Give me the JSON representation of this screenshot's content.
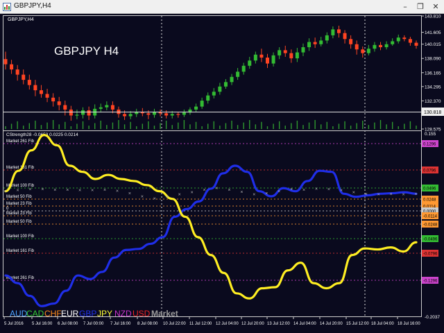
{
  "window": {
    "title": "GBPJPY,H4",
    "minimize_glyph": "–",
    "restore_glyph": "❐",
    "close_glyph": "✕"
  },
  "main_pane": {
    "symbol_label": "GBPJPY,H4",
    "watermark": "GBPJPY H4",
    "price_scale": [
      "143.810",
      "141.605",
      "140.015",
      "138.090",
      "136.165",
      "134.295",
      "132.370",
      "130.818",
      "128.575"
    ],
    "current_price": "130.818",
    "candles": [
      [
        138.0,
        137.3,
        139.0,
        136.6
      ],
      [
        137.3,
        136.6,
        137.9,
        136.0
      ],
      [
        136.6,
        135.9,
        137.2,
        135.1
      ],
      [
        135.9,
        135.2,
        136.6,
        134.6
      ],
      [
        135.2,
        134.5,
        135.9,
        133.9
      ],
      [
        134.5,
        133.8,
        135.2,
        133.0
      ],
      [
        133.8,
        133.3,
        134.5,
        132.8
      ],
      [
        133.3,
        132.8,
        134.0,
        132.2
      ],
      [
        132.8,
        132.3,
        133.4,
        131.6
      ],
      [
        132.3,
        131.8,
        132.9,
        131.1
      ],
      [
        131.8,
        131.2,
        132.4,
        130.4
      ],
      [
        131.2,
        130.4,
        131.7,
        129.7
      ],
      [
        130.4,
        130.5,
        131.2,
        129.9
      ],
      [
        130.5,
        131.1,
        131.5,
        130.0
      ],
      [
        131.1,
        130.4,
        131.6,
        129.8
      ],
      [
        130.4,
        131.3,
        131.9,
        130.0
      ],
      [
        131.3,
        131.5,
        132.0,
        130.8
      ],
      [
        131.5,
        131.8,
        132.3,
        131.1
      ],
      [
        131.8,
        131.2,
        132.3,
        130.7
      ],
      [
        131.2,
        130.6,
        131.6,
        130.1
      ],
      [
        130.6,
        130.3,
        131.1,
        129.8
      ],
      [
        130.3,
        130.6,
        131.0,
        129.9
      ],
      [
        130.6,
        130.9,
        131.3,
        130.2
      ],
      [
        130.9,
        130.7,
        131.4,
        130.3
      ],
      [
        130.7,
        130.5,
        131.1,
        129.9
      ],
      [
        130.5,
        130.9,
        131.3,
        130.1
      ],
      [
        130.9,
        130.7,
        131.2,
        130.3
      ],
      [
        130.7,
        130.4,
        131.1,
        130.0
      ],
      [
        130.4,
        130.6,
        131.0,
        130.0
      ],
      [
        130.6,
        130.5,
        130.9,
        130.1
      ],
      [
        130.5,
        130.8,
        131.2,
        130.2
      ],
      [
        130.8,
        131.2,
        131.5,
        130.5
      ],
      [
        131.2,
        131.6,
        132.0,
        130.9
      ],
      [
        131.6,
        132.4,
        132.8,
        131.3
      ],
      [
        132.4,
        133.1,
        133.5,
        132.0
      ],
      [
        133.1,
        133.6,
        134.1,
        132.7
      ],
      [
        133.6,
        134.3,
        134.8,
        133.2
      ],
      [
        134.3,
        134.9,
        135.3,
        134.0
      ],
      [
        134.9,
        135.6,
        136.0,
        134.5
      ],
      [
        135.6,
        136.3,
        136.8,
        135.2
      ],
      [
        136.3,
        137.1,
        137.5,
        135.9
      ],
      [
        137.1,
        137.8,
        138.3,
        136.7
      ],
      [
        137.8,
        138.6,
        139.0,
        137.4
      ],
      [
        138.6,
        138.2,
        139.4,
        137.6
      ],
      [
        138.2,
        137.4,
        138.7,
        136.8
      ],
      [
        137.4,
        138.5,
        138.9,
        137.0
      ],
      [
        138.5,
        139.2,
        139.6,
        138.0
      ],
      [
        139.2,
        138.8,
        139.8,
        138.3
      ],
      [
        138.8,
        138.1,
        139.3,
        137.5
      ],
      [
        138.1,
        138.9,
        139.5,
        137.6
      ],
      [
        138.9,
        139.6,
        140.1,
        138.4
      ],
      [
        139.6,
        140.3,
        140.8,
        139.1
      ],
      [
        140.3,
        140.0,
        140.9,
        139.5
      ],
      [
        140.0,
        140.5,
        141.0,
        139.7
      ],
      [
        140.5,
        141.2,
        141.6,
        140.1
      ],
      [
        141.2,
        142.0,
        142.4,
        140.8
      ],
      [
        142.0,
        141.5,
        142.5,
        140.9
      ],
      [
        141.5,
        140.7,
        141.9,
        140.1
      ],
      [
        140.7,
        140.0,
        141.2,
        139.4
      ],
      [
        140.0,
        139.3,
        140.5,
        138.6
      ],
      [
        139.3,
        138.8,
        139.7,
        138.2
      ],
      [
        138.8,
        139.4,
        139.9,
        138.5
      ],
      [
        139.4,
        139.9,
        140.3,
        139.0
      ],
      [
        139.9,
        139.6,
        140.3,
        139.2
      ],
      [
        139.6,
        140.0,
        140.4,
        139.3
      ],
      [
        140.0,
        140.4,
        140.8,
        139.8
      ],
      [
        140.4,
        140.9,
        141.3,
        140.1
      ],
      [
        140.9,
        140.7,
        141.2,
        140.4
      ],
      [
        140.7,
        140.2,
        141.0,
        139.8
      ],
      [
        140.2,
        139.8,
        140.5,
        139.4
      ]
    ]
  },
  "indicator_pane": {
    "header": "CStrength28 -0.0653 0.0225 0.0214",
    "scale_top": "0.155",
    "scale_bottom": "-0.2037",
    "levels": [
      {
        "label": "Market 261 Fib",
        "badge": "0.1296",
        "color": "#cc44cc"
      },
      {
        "label": "Market 161 Fib",
        "badge": "0.0796",
        "color": "#dd3333"
      },
      {
        "label": "Market 100 Fib",
        "badge": "0.0496",
        "color": "#33bb33"
      },
      {
        "label": "Market 50 Fib",
        "badge": "0.0248",
        "color": "#ff9933"
      },
      {
        "label": "Market 23 Fib",
        "badge": "0.0114",
        "color": "#ff9933"
      },
      {
        "label": "0",
        "badge": "0.0000",
        "color": "#cccccc"
      },
      {
        "label": "Market 23 Fib",
        "badge": "-0.0114",
        "color": "#ff9933"
      },
      {
        "label": "Market 50 Fib",
        "badge": "-0.0248",
        "color": "#ff9933"
      },
      {
        "label": "Market 100 Fib",
        "badge": "-0.0496",
        "color": "#33bb33"
      },
      {
        "label": "Market 161 Fib",
        "badge": "-0.0796",
        "color": "#dd3333"
      },
      {
        "label": "Market 261 Fib",
        "badge": "-0.1296",
        "color": "#cc44cc"
      }
    ],
    "currency_legend": [
      {
        "code": "AUD",
        "color": "#4aa3ff"
      },
      {
        "code": "CAD",
        "color": "#33cc33"
      },
      {
        "code": "CHF",
        "color": "#ff8c1a"
      },
      {
        "code": "EUR",
        "color": "#ffffff"
      },
      {
        "code": "GBP",
        "color": "#2233ee"
      },
      {
        "code": "JPY",
        "color": "#ffff33"
      },
      {
        "code": "NZD",
        "color": "#cc33cc"
      },
      {
        "code": "USD",
        "color": "#ee2222"
      },
      {
        "code": "Market",
        "color": "#9a9a9a"
      }
    ]
  },
  "time_axis": [
    "5 Jul 2016",
    "5 Jul 16:00",
    "6 Jul 08:00",
    "7 Jul 00:00",
    "7 Jul 16:00",
    "8 Jul 08:00",
    "10 Jul 22:00",
    "11 Jul 12:00",
    "12 Jul 04:00",
    "12 Jul 20:00",
    "13 Jul 12:00",
    "14 Jul 04:00",
    "14 Jul 20:00",
    "15 Jul 12:00",
    "18 Jul 04:00",
    "18 Jul 16:00"
  ],
  "colors": {
    "background": "#0a0a1e",
    "bull": "#33bb33",
    "bear": "#ff4422",
    "jpy_line": "#ffee22",
    "gbp_line": "#1f2ee8",
    "market_line": "#b0b0b0",
    "grid": "#ffffff"
  },
  "chart_data": {
    "type": "line",
    "series": [
      {
        "name": "GBP",
        "color": "#1f2ee8",
        "values": [
          -0.125,
          -0.14,
          -0.165,
          -0.185,
          -0.18,
          -0.155,
          -0.125,
          -0.132,
          -0.118,
          -0.09,
          -0.075,
          -0.073,
          -0.063,
          -0.05,
          -0.01,
          0.005,
          0.02,
          0.045,
          0.075,
          0.09,
          0.078,
          0.04,
          0.03,
          0.046,
          0.04,
          0.06,
          0.08,
          0.078,
          0.035,
          0.029,
          0.032,
          0.035,
          0.036,
          0.038,
          0.035
        ]
      },
      {
        "name": "JPY",
        "color": "#ffee22",
        "values": [
          0.04,
          0.08,
          0.12,
          0.15,
          0.13,
          0.09,
          0.078,
          0.064,
          0.072,
          0.064,
          0.06,
          0.052,
          0.04,
          0.025,
          -0.01,
          -0.05,
          -0.085,
          -0.12,
          -0.16,
          -0.17,
          -0.15,
          -0.148,
          -0.115,
          -0.1,
          -0.14,
          -0.15,
          -0.14,
          -0.085,
          -0.072,
          -0.074,
          -0.07,
          -0.078,
          -0.06
        ]
      },
      {
        "name": "Market",
        "color": "#b0b0b0",
        "values": [
          0.04,
          0.042,
          0.044,
          0.044,
          0.043,
          0.043,
          0.042,
          0.042,
          0.043,
          0.041,
          0.036,
          0.03,
          0.026,
          0.03,
          0.034,
          0.038,
          0.043,
          0.046,
          0.043,
          0.039,
          0.034,
          0.036,
          0.04,
          0.044,
          0.043,
          0.045,
          0.044,
          0.042,
          0.038,
          0.035,
          0.034,
          0.035,
          0.034,
          0.035
        ]
      }
    ],
    "ylim": [
      -0.2037,
      0.155
    ]
  }
}
